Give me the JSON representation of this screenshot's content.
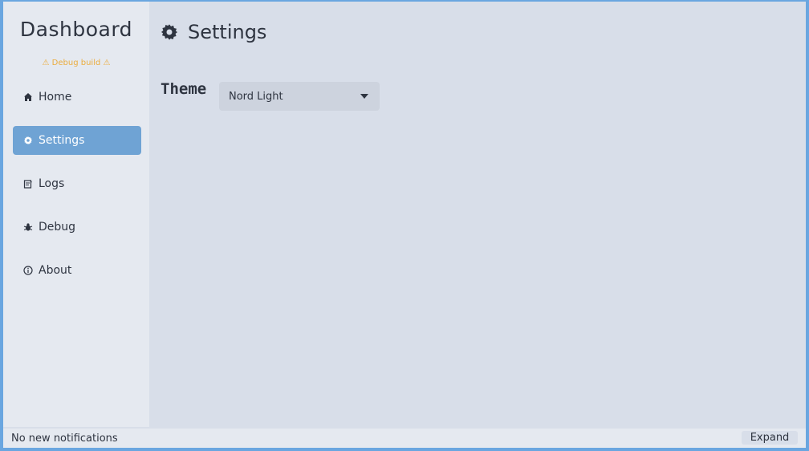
{
  "sidebar": {
    "title": "Dashboard",
    "debug_note": "⚠ Debug build ⚠",
    "items": [
      {
        "label": "Home",
        "icon": "home-icon"
      },
      {
        "label": "Settings",
        "icon": "gear-icon",
        "active": true
      },
      {
        "label": "Logs",
        "icon": "log-icon"
      },
      {
        "label": "Debug",
        "icon": "bug-icon"
      },
      {
        "label": "About",
        "icon": "info-icon"
      }
    ]
  },
  "main": {
    "title": "Settings",
    "title_icon": "gear-icon",
    "theme_label": "Theme",
    "theme_value": "Nord Light"
  },
  "statusbar": {
    "text": "No new notifications",
    "expand_label": "Expand"
  },
  "colors": {
    "accent": "#6fa3d4",
    "warning": "#ebad3f",
    "background": "#d8dee9",
    "sidebar": "#e5e9f0",
    "text": "#2e3440"
  }
}
